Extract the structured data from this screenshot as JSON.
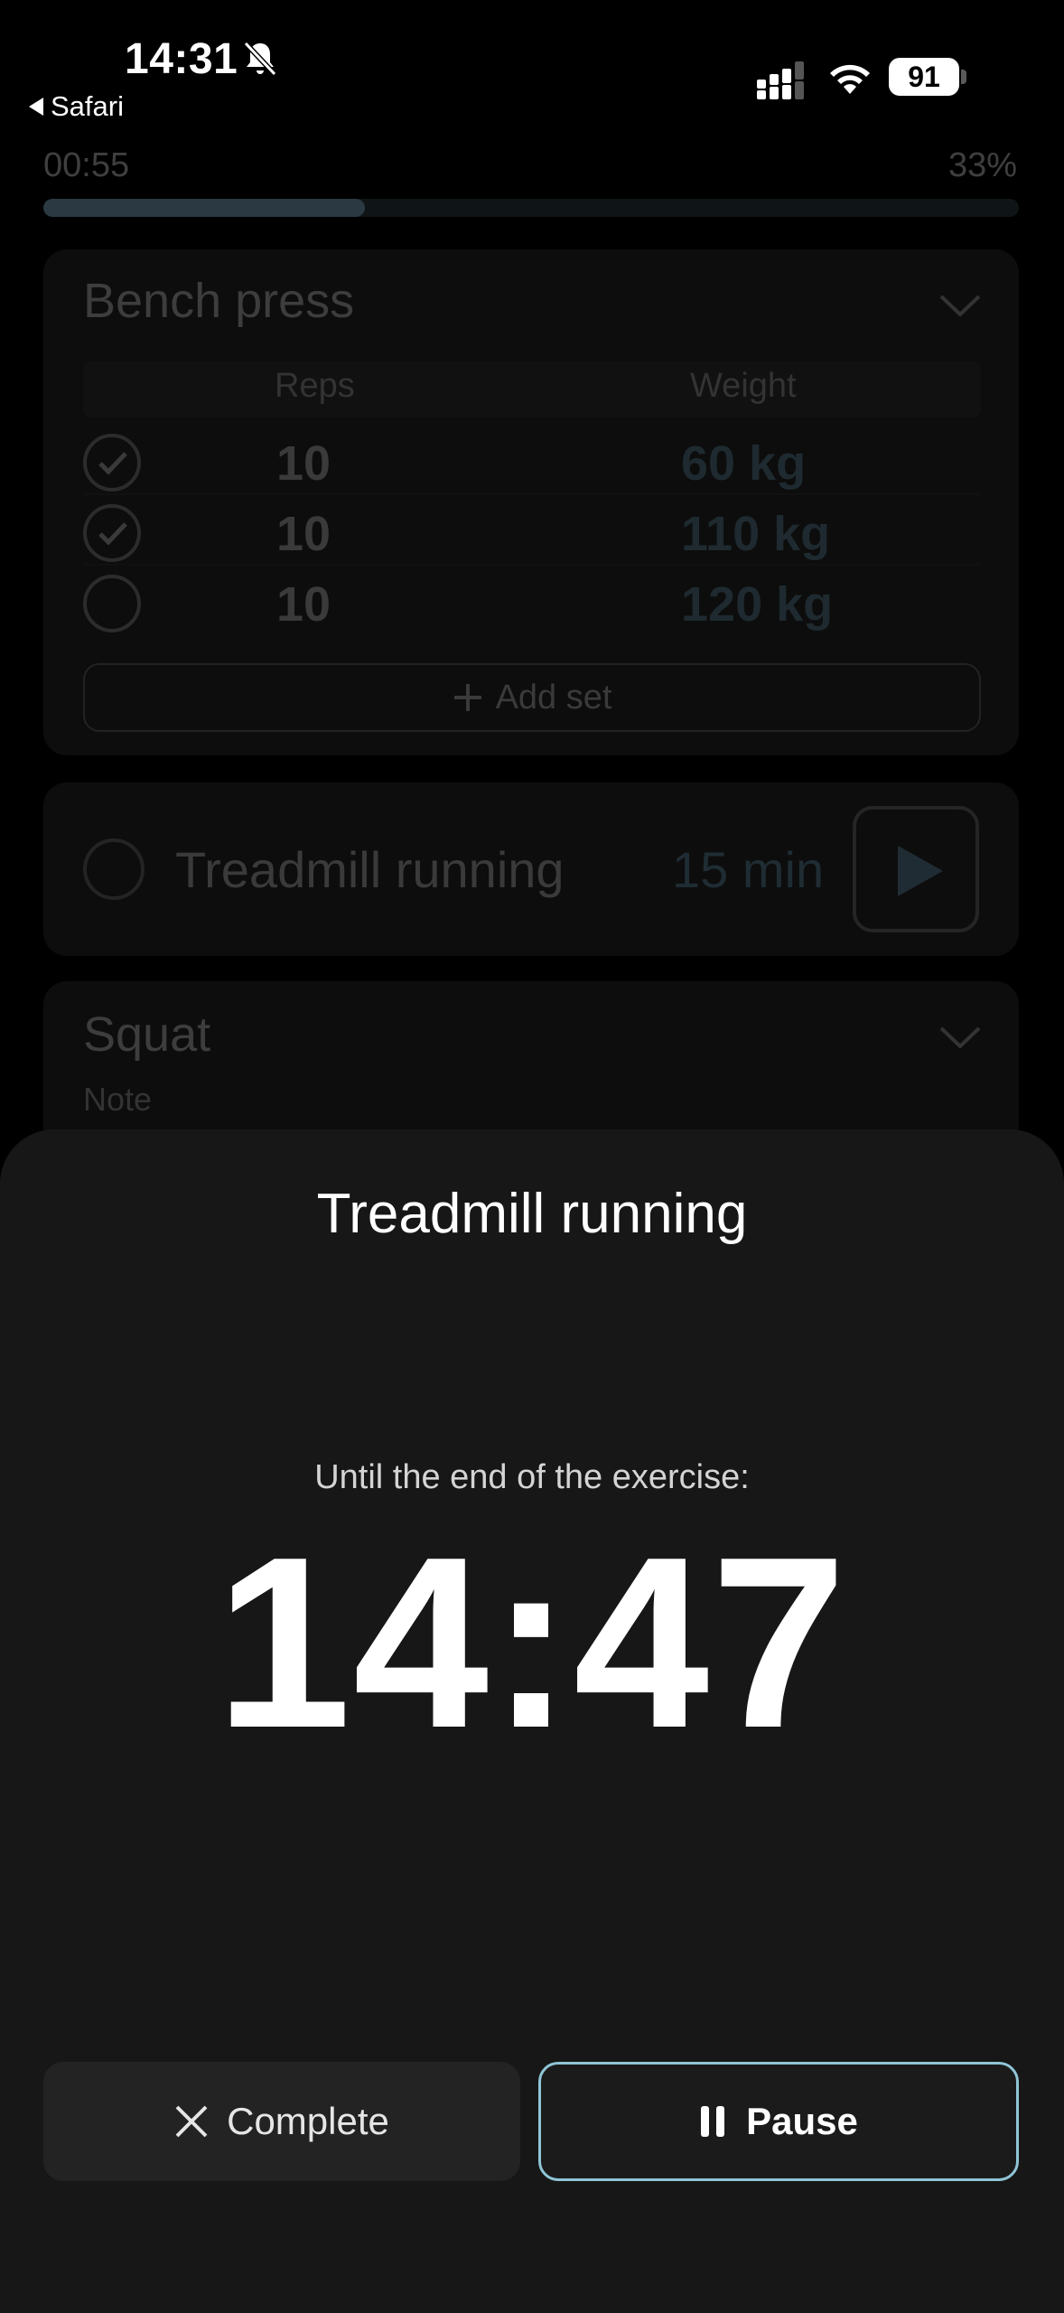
{
  "status_bar": {
    "time": "14:31",
    "back_label": "Safari",
    "battery": "91",
    "icons": [
      "bell-off-icon",
      "signal-icon",
      "wifi-icon",
      "battery-icon"
    ]
  },
  "workout_progress": {
    "elapsed": "00:55",
    "percent_label": "33%",
    "fraction": 0.33
  },
  "exercises": {
    "bench": {
      "title": "Bench press",
      "columns": {
        "reps": "Reps",
        "weight": "Weight"
      },
      "sets": [
        {
          "done": true,
          "reps": "10",
          "weight": "60 kg"
        },
        {
          "done": true,
          "reps": "10",
          "weight": "110 kg"
        },
        {
          "done": false,
          "reps": "10",
          "weight": "120 kg"
        }
      ],
      "add_set": "Add set"
    },
    "treadmill": {
      "title": "Treadmill running",
      "duration": "15 min"
    },
    "squat": {
      "title": "Squat",
      "note_placeholder": "Note"
    }
  },
  "timer_sheet": {
    "title": "Treadmill running",
    "subtitle": "Until the end of the exercise:",
    "remaining": "14:47",
    "complete_label": "Complete",
    "pause_label": "Pause"
  },
  "colors": {
    "accent_border": "#8fc5d6",
    "sheet_bg": "#171717",
    "background": "#000000"
  }
}
